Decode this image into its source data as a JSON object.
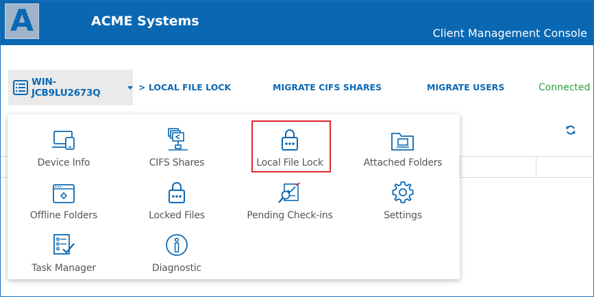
{
  "header": {
    "logo_letter": "A",
    "title": "ACME Systems",
    "subtitle": "Client Management Console"
  },
  "nav": {
    "device": "WIN-JCB9LU2673Q",
    "breadcrumb": "> LOCAL FILE LOCK",
    "links": [
      "MIGRATE CIFS SHARES",
      "MIGRATE USERS"
    ],
    "status": "Connected"
  },
  "menu": {
    "selected": "Local File Lock",
    "items": [
      {
        "label": "Device Info",
        "icon": "device-info-icon"
      },
      {
        "label": "CIFS Shares",
        "icon": "cifs-shares-icon"
      },
      {
        "label": "Local File Lock",
        "icon": "lock-icon"
      },
      {
        "label": "Attached Folders",
        "icon": "attached-folder-icon"
      },
      {
        "label": "Offline Folders",
        "icon": "offline-folder-icon"
      },
      {
        "label": "Locked Files",
        "icon": "locked-files-icon"
      },
      {
        "label": "Pending Check-ins",
        "icon": "pending-checkin-icon"
      },
      {
        "label": "Settings",
        "icon": "gear-icon"
      },
      {
        "label": "Task Manager",
        "icon": "task-manager-icon"
      },
      {
        "label": "Diagnostic",
        "icon": "info-icon"
      }
    ]
  },
  "colors": {
    "brand": "#0a68b3",
    "status_ok": "#2e9b3e",
    "selection": "#e0262b",
    "icon": "#0a68b3"
  }
}
